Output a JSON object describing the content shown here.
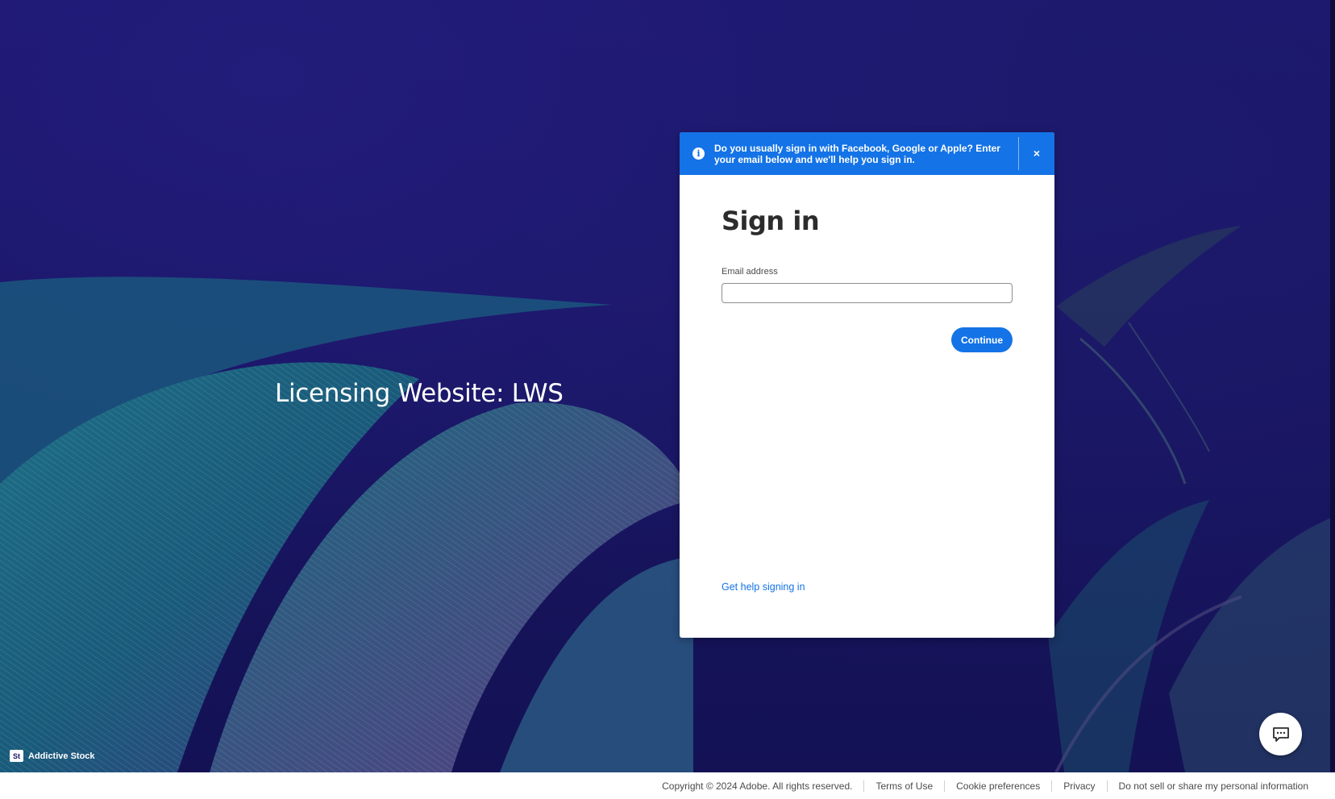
{
  "hero": {
    "title": "Licensing Website: LWS"
  },
  "brand": {
    "logo": "St",
    "name": "Addictive Stock"
  },
  "banner": {
    "icon": "info-icon",
    "text": "Do you usually sign in with Facebook, Google or Apple? Enter your email below and we'll help you sign in.",
    "close": "×"
  },
  "signin": {
    "title": "Sign in",
    "email_label": "Email address",
    "email_value": "",
    "continue_label": "Continue",
    "help_link": "Get help signing in"
  },
  "footer": {
    "copyright": "Copyright © 2024 Adobe. All rights reserved.",
    "links": [
      "Terms of Use",
      "Cookie preferences",
      "Privacy",
      "Do not sell or share my personal information"
    ]
  },
  "chat": {
    "icon": "chat-bubble-icon"
  },
  "colors": {
    "accent": "#1473e6",
    "background": "#1a1660"
  }
}
